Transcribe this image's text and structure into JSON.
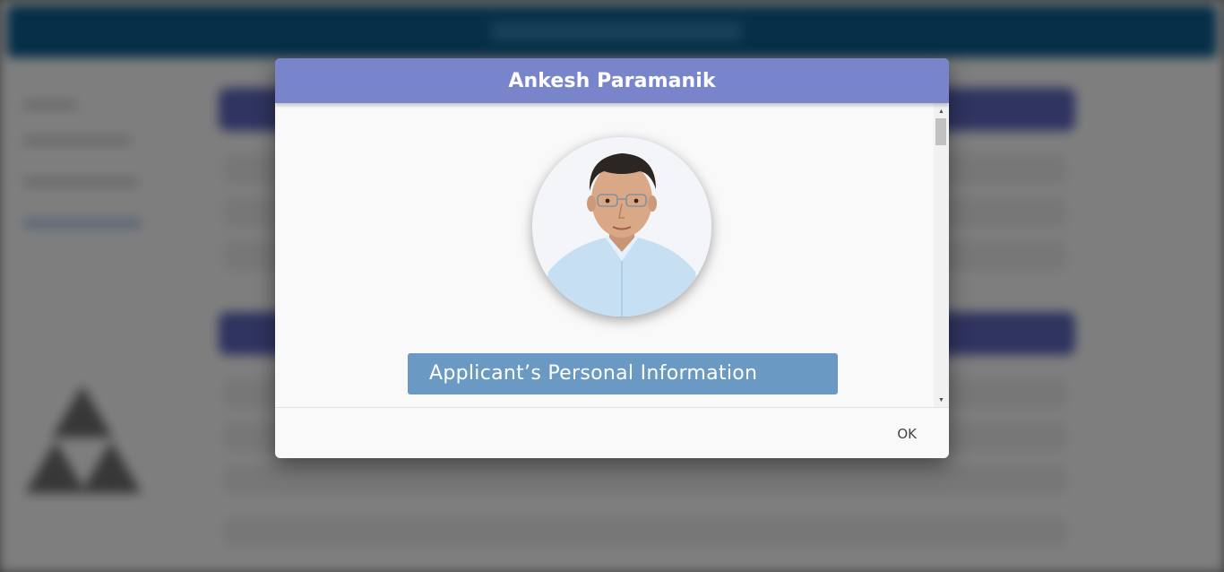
{
  "dialog": {
    "title": "Ankesh Paramanik",
    "photo_alt": "Applicant photo",
    "section_heading": "Applicant’s Personal Information",
    "ok_label": "OK"
  },
  "colors": {
    "header": "#7985cb",
    "section_heading": "#6a9ac3",
    "background_topbar": "#0c5a8a",
    "background_band": "#5b64b8"
  },
  "icons": {
    "scroll_up": "scroll-up-arrow-icon",
    "scroll_down": "scroll-down-arrow-icon"
  }
}
